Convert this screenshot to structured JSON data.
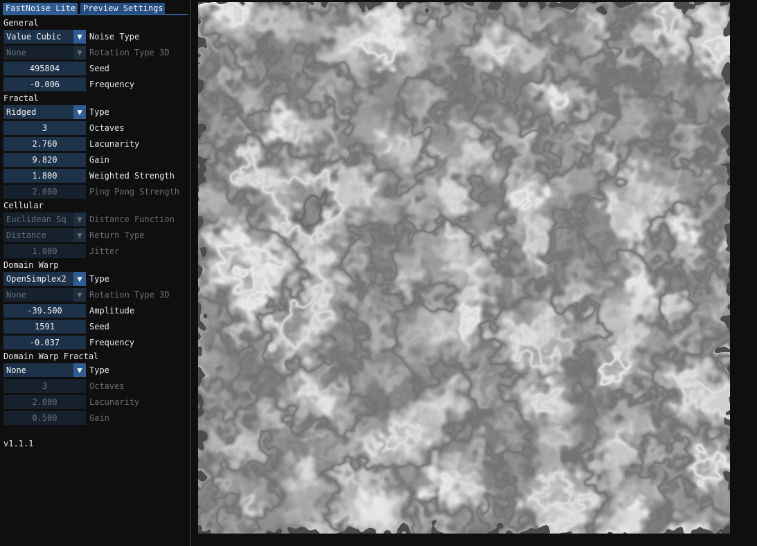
{
  "tabs": [
    "FastNoise Lite",
    "Preview Settings"
  ],
  "general": {
    "title": "General",
    "noise_type": {
      "value": "Value Cubic",
      "label": "Noise Type"
    },
    "rotation_type_3d": {
      "value": "None",
      "label": "Rotation Type 3D"
    },
    "seed": {
      "value": "495804",
      "label": "Seed"
    },
    "frequency": {
      "value": "-0.006",
      "label": "Frequency"
    }
  },
  "fractal": {
    "title": "Fractal",
    "type": {
      "value": "Ridged",
      "label": "Type"
    },
    "octaves": {
      "value": "3",
      "label": "Octaves"
    },
    "lacunarity": {
      "value": "2.760",
      "label": "Lacunarity"
    },
    "gain": {
      "value": "9.820",
      "label": "Gain"
    },
    "weighted_strength": {
      "value": "1.800",
      "label": "Weighted Strength"
    },
    "ping_pong_strength": {
      "value": "2.000",
      "label": "Ping Pong Strength"
    }
  },
  "cellular": {
    "title": "Cellular",
    "distance_function": {
      "value": "Euclidean Sq",
      "label": "Distance Function"
    },
    "return_type": {
      "value": "Distance",
      "label": "Return Type"
    },
    "jitter": {
      "value": "1.000",
      "label": "Jitter"
    }
  },
  "domain_warp": {
    "title": "Domain Warp",
    "type": {
      "value": "OpenSimplex2",
      "label": "Type"
    },
    "rotation_type_3d": {
      "value": "None",
      "label": "Rotation Type 3D"
    },
    "amplitude": {
      "value": "-39.500",
      "label": "Amplitude"
    },
    "seed": {
      "value": "1591",
      "label": "Seed"
    },
    "frequency": {
      "value": "-0.037",
      "label": "Frequency"
    }
  },
  "domain_warp_fractal": {
    "title": "Domain Warp Fractal",
    "type": {
      "value": "None",
      "label": "Type"
    },
    "octaves": {
      "value": "3",
      "label": "Octaves"
    },
    "lacunarity": {
      "value": "2.000",
      "label": "Lacunarity"
    },
    "gain": {
      "value": "0.500",
      "label": "Gain"
    }
  },
  "version": "v1.1.1",
  "icons": {
    "dropdown": "caret-down-icon"
  },
  "colors": {
    "accent": "#2f5c93",
    "frame_bg": "#1d3249",
    "panel_bg": "#0f0f0f",
    "preview_base": "#7a7a7a"
  }
}
